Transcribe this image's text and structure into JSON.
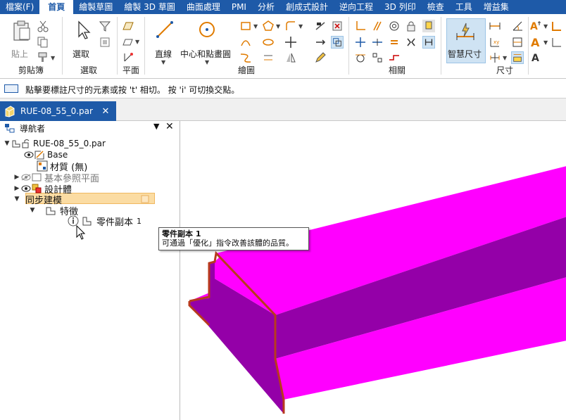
{
  "menu": {
    "items": [
      "檔案(F)",
      "首頁",
      "繪製草圖",
      "繪製 3D 草圖",
      "曲面處理",
      "PMI",
      "分析",
      "創成式設計",
      "逆向工程",
      "3D 列印",
      "檢查",
      "工具",
      "增益集"
    ],
    "active_index": 1
  },
  "ribbon": {
    "groups": {
      "clipboard": "剪貼簿",
      "select": "選取",
      "plane": "平面",
      "draw": "繪圖",
      "relate": "相關",
      "dimension": "尺寸"
    },
    "buttons": {
      "paste": "貼上",
      "select": "選取",
      "line": "直線",
      "center_point_circle": "中心和點畫圓",
      "smart_dimension": "智慧尺寸"
    }
  },
  "prompt": {
    "text": "點擊要標註尺寸的元素或按 't' 相切。 按 'i' 可切換交點。"
  },
  "document_tab": {
    "label": "RUE-08_55_0.par",
    "close": "✕"
  },
  "navigator": {
    "title": "導航者",
    "pin": "▼",
    "close": "✕",
    "tree": {
      "root": "RUE-08_55_0.par",
      "base": "Base",
      "material": "材質 (無)",
      "base_planes": "基本參照平面",
      "design_body": "設計體",
      "sync_modeling": "同步建模",
      "features": "特徵",
      "part_copy": "零件副本",
      "part_copy_num": "1"
    }
  },
  "tooltip": {
    "title": "零件副本 1",
    "body": "可通過「優化」指令改善該體的品質。"
  },
  "colors": {
    "accent": "#1e5aa8",
    "part_top": "#ff00ff",
    "part_side": "#9400a8",
    "part_edge": "#b83a1e",
    "sync_highlight": "#fbdca3"
  }
}
